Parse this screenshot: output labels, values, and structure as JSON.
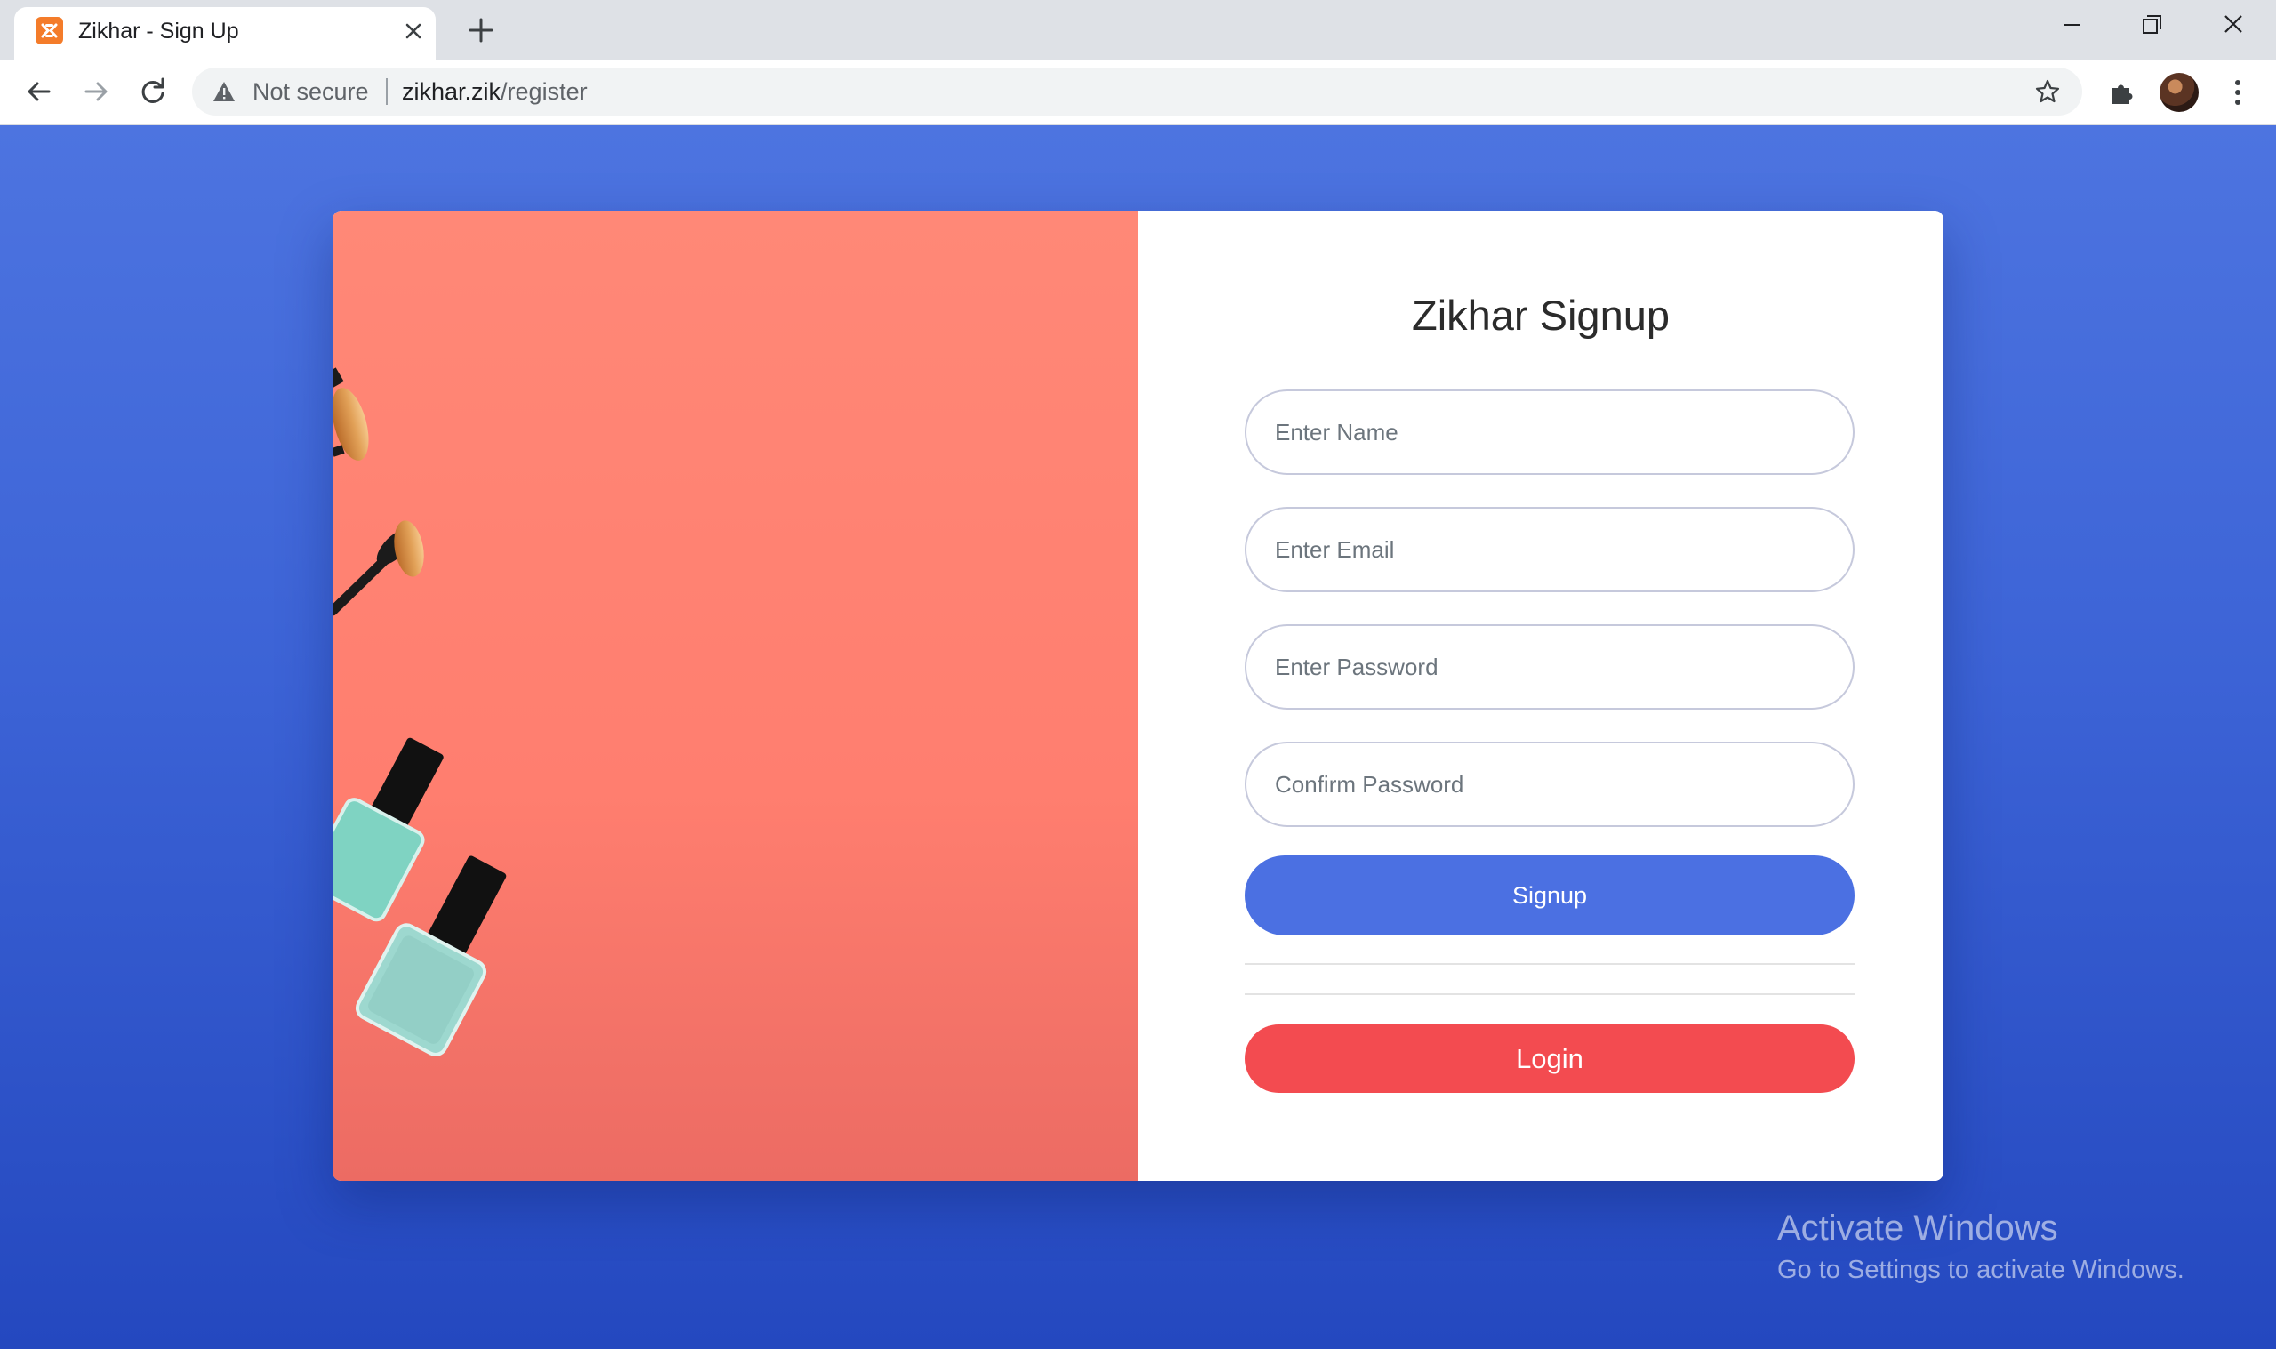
{
  "browser": {
    "tab_title": "Zikhar - Sign Up",
    "security_label": "Not secure",
    "url_host": "zikhar.zik",
    "url_path": "/register"
  },
  "signup": {
    "title": "Zikhar Signup",
    "name_placeholder": "Enter Name",
    "email_placeholder": "Enter Email",
    "password_placeholder": "Enter Password",
    "confirm_placeholder": "Confirm Password",
    "signup_label": "Signup",
    "login_label": "Login"
  },
  "watermark": {
    "title": "Activate Windows",
    "subtitle": "Go to Settings to activate Windows."
  },
  "colors": {
    "page_background": "#3d63d6",
    "image_panel": "#ff8474",
    "signup_button": "#4b70e2",
    "login_button": "#f34b50"
  }
}
